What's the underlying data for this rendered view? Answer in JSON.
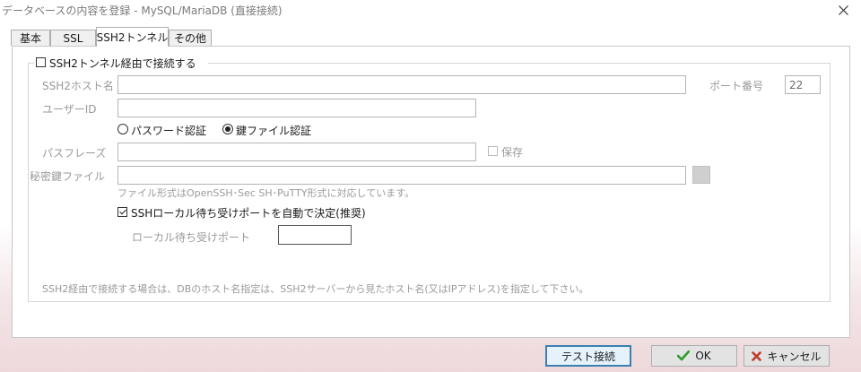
{
  "window": {
    "title": "データベースの内容を登録 - MySQL/MariaDB (直接接続)"
  },
  "tabs": [
    {
      "label": "基本",
      "active": false
    },
    {
      "label": "SSL",
      "active": false
    },
    {
      "label": "SSH2トンネル",
      "active": true
    },
    {
      "label": "その他",
      "active": false
    }
  ],
  "ssh": {
    "use_tunnel_label": "SSH2トンネル経由で接続する",
    "use_tunnel_checked": false,
    "host_label": "SSH2ホスト名",
    "host_value": "",
    "port_label": "ポート番号",
    "port_value": "22",
    "user_label": "ユーザーID",
    "user_value": "",
    "auth_password_label": "パスワード認証",
    "auth_key_label": "鍵ファイル認証",
    "auth_selected": "鍵ファイル認証",
    "passphrase_label": "パスフレーズ",
    "passphrase_value": "",
    "save_label": "保存",
    "keyfile_label": "秘密鍵ファイル",
    "keyfile_value": "",
    "keyfile_hint": "ファイル形式はOpenSSH･Sec SH･PuTTY形式に対応しています。",
    "auto_port_label": "SSHローカル待ち受けポートを自動で決定(推奨)",
    "auto_port_checked": true,
    "local_port_label": "ローカル待ち受けポート",
    "local_port_value": "",
    "note": "SSH2経由で接続する場合は、DBのホスト名指定は、SSH2サーバーから見たホスト名(又はIPアドレス)を指定して下さい。"
  },
  "buttons": {
    "test_label": "テスト接続",
    "ok_label": "OK",
    "cancel_label": "キャンセル"
  },
  "icons": {
    "close": "close-icon",
    "ok": "checkmark-icon",
    "cancel": "cross-icon"
  },
  "colors": {
    "ok_icon": "#2e9b2e",
    "cancel_icon": "#c0392b",
    "default_button_border": "#3c7fb1"
  }
}
